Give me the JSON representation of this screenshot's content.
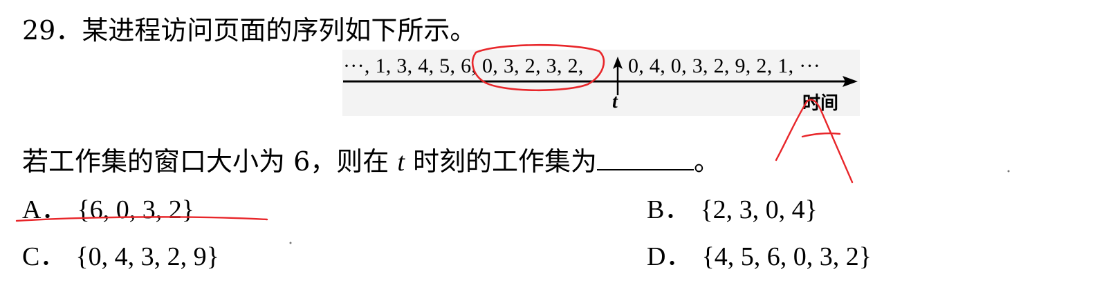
{
  "question": {
    "title": "29．某进程访问页面的序列如下所示。",
    "sequence_before": "···, 1, 3, 4, 5, 6, 0, 3, 2, 3, 2,",
    "sequence_after": "0, 4, 0, 3, 2, 9, 2, 1, ···",
    "time_marker": "t",
    "axis_label": "时间",
    "prompt_before": "若工作集的窗口大小为 6，则在 ",
    "prompt_var": "t",
    "prompt_after": " 时刻的工作集为",
    "prompt_end": "。"
  },
  "options": [
    {
      "letter": "A．",
      "text": "{6, 0, 3, 2}"
    },
    {
      "letter": "B．",
      "text": "{2, 3, 0, 4}"
    },
    {
      "letter": "C．",
      "text": "{0, 4, 3, 2, 9}"
    },
    {
      "letter": "D．",
      "text": "{4, 5, 6, 0, 3, 2}"
    }
  ],
  "annotation": {
    "handwritten_answer": "A",
    "ink_color": "#e8262a"
  }
}
